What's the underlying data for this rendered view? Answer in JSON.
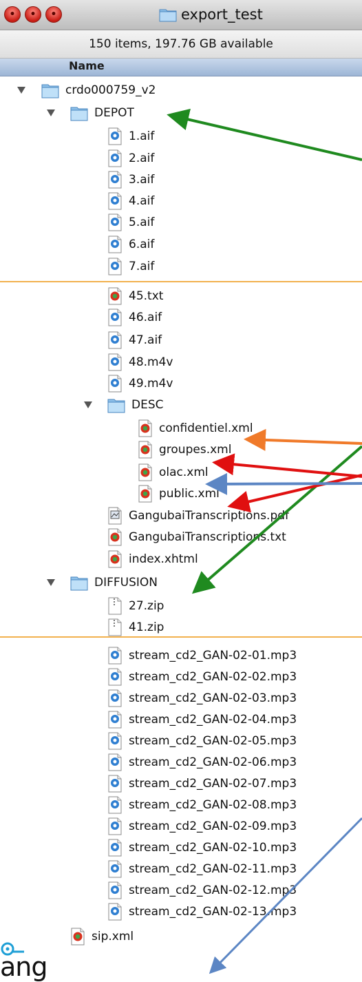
{
  "window": {
    "title": "export_test",
    "status": "150 items, 197.76 GB available",
    "column_header": "Name"
  },
  "items": [
    {
      "label": "crdo000759_v2",
      "icon": "folder-icon",
      "indent": 0,
      "expanded": true
    },
    {
      "label": "DEPOT",
      "icon": "folder-icon",
      "indent": 1,
      "expanded": true
    },
    {
      "label": "1.aif",
      "icon": "audio-file-icon",
      "indent": 2
    },
    {
      "label": "2.aif",
      "icon": "audio-file-icon",
      "indent": 2
    },
    {
      "label": "3.aif",
      "icon": "audio-file-icon",
      "indent": 2
    },
    {
      "label": "4.aif",
      "icon": "audio-file-icon",
      "indent": 2
    },
    {
      "label": "5.aif",
      "icon": "audio-file-icon",
      "indent": 2
    },
    {
      "label": "6.aif",
      "icon": "audio-file-icon",
      "indent": 2
    },
    {
      "label": "7.aif",
      "icon": "audio-file-icon",
      "indent": 2
    },
    {
      "label": "45.txt",
      "icon": "text-file-icon",
      "indent": 2
    },
    {
      "label": "46.aif",
      "icon": "audio-file-icon",
      "indent": 2
    },
    {
      "label": "47.aif",
      "icon": "audio-file-icon",
      "indent": 2
    },
    {
      "label": "48.m4v",
      "icon": "video-file-icon",
      "indent": 2
    },
    {
      "label": "49.m4v",
      "icon": "video-file-icon",
      "indent": 2
    },
    {
      "label": "DESC",
      "icon": "folder-icon",
      "indent": 2,
      "expanded": true
    },
    {
      "label": "confidentiel.xml",
      "icon": "xml-file-icon",
      "indent": 3
    },
    {
      "label": "groupes.xml",
      "icon": "xml-file-icon",
      "indent": 3
    },
    {
      "label": "olac.xml",
      "icon": "xml-file-icon",
      "indent": 3
    },
    {
      "label": "public.xml",
      "icon": "xml-file-icon",
      "indent": 3
    },
    {
      "label": "GangubaiTranscriptions.pdf",
      "icon": "pdf-file-icon",
      "indent": 2
    },
    {
      "label": "GangubaiTranscriptions.txt",
      "icon": "text-file-icon",
      "indent": 2
    },
    {
      "label": "index.xhtml",
      "icon": "xml-file-icon",
      "indent": 2
    },
    {
      "label": "DIFFUSION",
      "icon": "folder-icon",
      "indent": 1,
      "expanded": true
    },
    {
      "label": "27.zip",
      "icon": "zip-file-icon",
      "indent": 2
    },
    {
      "label": "41.zip",
      "icon": "zip-file-icon",
      "indent": 2
    },
    {
      "label": "stream_cd2_GAN-02-01.mp3",
      "icon": "audio-file-icon",
      "indent": 2
    },
    {
      "label": "stream_cd2_GAN-02-02.mp3",
      "icon": "audio-file-icon",
      "indent": 2
    },
    {
      "label": "stream_cd2_GAN-02-03.mp3",
      "icon": "audio-file-icon",
      "indent": 2
    },
    {
      "label": "stream_cd2_GAN-02-04.mp3",
      "icon": "audio-file-icon",
      "indent": 2
    },
    {
      "label": "stream_cd2_GAN-02-05.mp3",
      "icon": "audio-file-icon",
      "indent": 2
    },
    {
      "label": "stream_cd2_GAN-02-06.mp3",
      "icon": "audio-file-icon",
      "indent": 2
    },
    {
      "label": "stream_cd2_GAN-02-07.mp3",
      "icon": "audio-file-icon",
      "indent": 2
    },
    {
      "label": "stream_cd2_GAN-02-08.mp3",
      "icon": "audio-file-icon",
      "indent": 2
    },
    {
      "label": "stream_cd2_GAN-02-09.mp3",
      "icon": "audio-file-icon",
      "indent": 2
    },
    {
      "label": "stream_cd2_GAN-02-10.mp3",
      "icon": "audio-file-icon",
      "indent": 2
    },
    {
      "label": "stream_cd2_GAN-02-11.mp3",
      "icon": "audio-file-icon",
      "indent": 2
    },
    {
      "label": "stream_cd2_GAN-02-12.mp3",
      "icon": "audio-file-icon",
      "indent": 2
    },
    {
      "label": "stream_cd2_GAN-02-13.mp3",
      "icon": "audio-file-icon",
      "indent": 2
    },
    {
      "label": "sip.xml",
      "icon": "xml-file-icon",
      "indent": 1
    }
  ],
  "logo": {
    "text": "ang"
  },
  "colors": {
    "green_arrow": "#1f8a1f",
    "red_arrow": "#e01010",
    "orange_arrow": "#f07a2a",
    "blue_arrow": "#5c86c4",
    "separator": "#f2b04d",
    "logo_accent": "#1e9fd6"
  }
}
